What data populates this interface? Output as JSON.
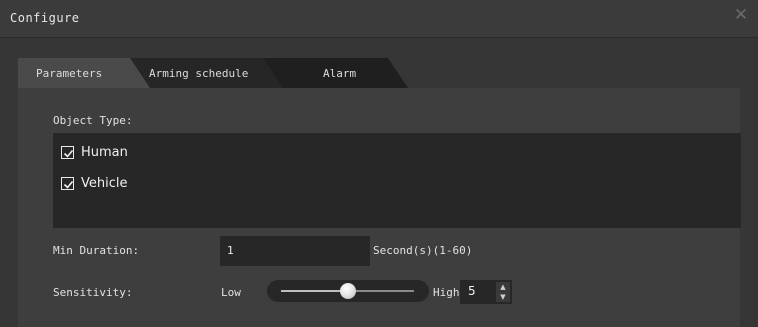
{
  "window": {
    "title": "Configure",
    "close_glyph": "✕"
  },
  "tabs": [
    {
      "label": "Parameters",
      "active": true
    },
    {
      "label": "Arming schedule",
      "active": false
    },
    {
      "label": "Alarm",
      "active": false
    }
  ],
  "object_type": {
    "label": "Object Type:",
    "items": [
      {
        "label": "Human",
        "checked": true
      },
      {
        "label": "Vehicle",
        "checked": true
      }
    ]
  },
  "min_duration": {
    "label": "Min Duration:",
    "value": "1",
    "unit_hint": "Second(s)(1-60)"
  },
  "sensitivity": {
    "label": "Sensitivity:",
    "low_label": "Low",
    "high_label": "High",
    "level_fraction": 0.5,
    "value": "5"
  },
  "icons": {
    "close": "close-icon",
    "check": "checkmark-icon",
    "spin_up": "caret-up-icon",
    "spin_down": "caret-down-icon"
  },
  "colors": {
    "panel_bg": "#3e3e3e",
    "field_bg": "#272727",
    "tab_active": "#4a4a4a",
    "tab_inactive": "#1f1f1f"
  }
}
